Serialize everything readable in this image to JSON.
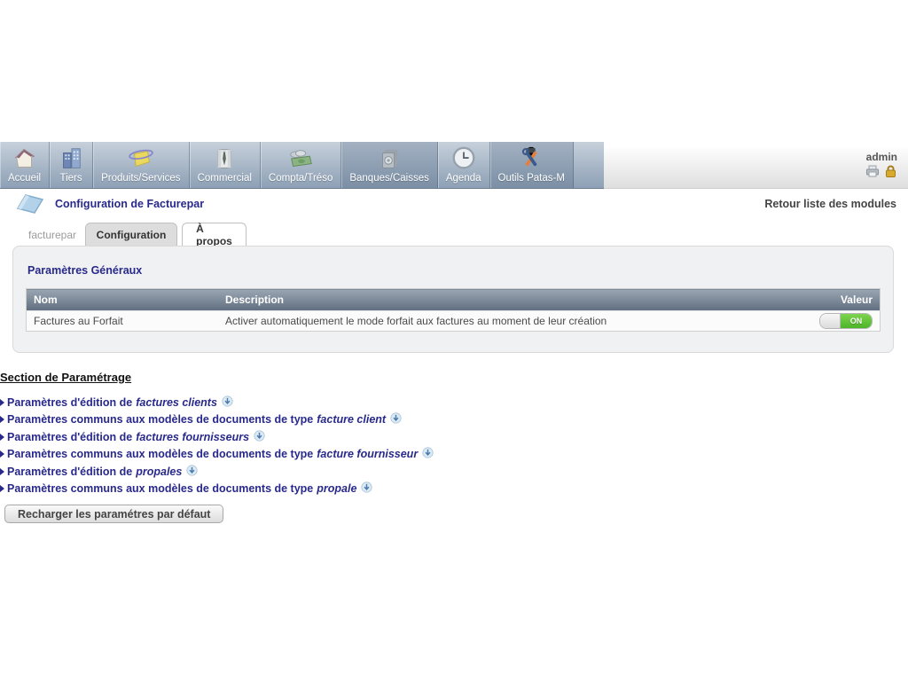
{
  "user": {
    "name": "admin",
    "icons": [
      {
        "name": "printer-icon"
      },
      {
        "name": "lock-icon"
      }
    ]
  },
  "menu": {
    "items": [
      {
        "label": "Accueil",
        "icon": "home-icon",
        "active": false
      },
      {
        "label": "Tiers",
        "icon": "buildings-icon",
        "active": false
      },
      {
        "label": "Produits/Services",
        "icon": "product-icon",
        "active": false
      },
      {
        "label": "Commercial",
        "icon": "shirt-icon",
        "active": false
      },
      {
        "label": "Compta/Tréso",
        "icon": "money-icon",
        "active": false
      },
      {
        "label": "Banques/Caisses",
        "icon": "safe-icon",
        "active": true
      },
      {
        "label": "Agenda",
        "icon": "clock-icon",
        "active": false
      },
      {
        "label": "Outils Patas-M",
        "icon": "tools-icon",
        "active": true
      }
    ]
  },
  "breadcrumb": {
    "title": "Configuration de Facturepar",
    "back_link": "Retour liste des modules"
  },
  "tabs": {
    "module_label": "facturepar",
    "items": [
      {
        "label": "Configuration",
        "active": true
      },
      {
        "label": "À propos",
        "active": false
      }
    ]
  },
  "panel": {
    "title": "Paramètres Généraux",
    "table": {
      "headers": [
        "Nom",
        "Description",
        "Valeur"
      ],
      "rows": [
        {
          "name": "Factures au Forfait",
          "description": "Activer automatiquement le mode forfait aux factures au moment de leur création",
          "value_state": "on",
          "value_label": "ON"
        }
      ]
    }
  },
  "section": {
    "title": "Section de Paramétrage",
    "links": [
      {
        "prefix": "Paramètres d'édition de",
        "italic": "factures clients"
      },
      {
        "prefix": "Paramètres communs aux modèles de documents de type",
        "italic": "facture client"
      },
      {
        "prefix": "Paramètres d'édition de",
        "italic": "factures fournisseurs"
      },
      {
        "prefix": "Paramètres communs aux modèles de documents de type",
        "italic": "facture fournisseur"
      },
      {
        "prefix": "Paramètres d'édition de",
        "italic": "propales"
      },
      {
        "prefix": "Paramètres communs aux modèles de documents de type",
        "italic": "propale"
      }
    ],
    "reload_button": "Recharger les paramétres par défaut"
  },
  "colors": {
    "accent_navy": "#29298c",
    "toggle_on_green": "#4cb527",
    "menubar_top": "#c6d0db",
    "menubar_bottom": "#8da0b5",
    "table_header_top": "#9ba6b2",
    "table_header_bottom": "#5f6e80"
  }
}
